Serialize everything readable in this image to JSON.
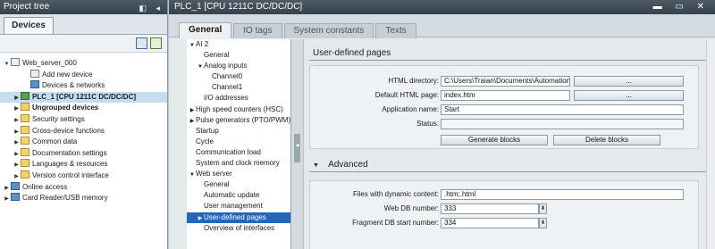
{
  "project_tree": {
    "title": "Project tree",
    "devices_tab": "Devices",
    "items": [
      {
        "label": "Web_server_000",
        "depth": 0,
        "arrow": "▼",
        "icon": "project"
      },
      {
        "label": "Add new device",
        "depth": 2,
        "arrow": "",
        "icon": "add-device"
      },
      {
        "label": "Devices & networks",
        "depth": 2,
        "arrow": "",
        "icon": "network"
      },
      {
        "label": "PLC_1 [CPU 1211C DC/DC/DC]",
        "depth": 1,
        "arrow": "▶",
        "icon": "plc",
        "selected": true
      },
      {
        "label": "Ungrouped devices",
        "depth": 1,
        "arrow": "▶",
        "icon": "folder",
        "bold": true
      },
      {
        "label": "Security settings",
        "depth": 1,
        "arrow": "▶",
        "icon": "security"
      },
      {
        "label": "Cross-device functions",
        "depth": 1,
        "arrow": "▶",
        "icon": "cross-device"
      },
      {
        "label": "Common data",
        "depth": 1,
        "arrow": "▶",
        "icon": "common-data"
      },
      {
        "label": "Documentation settings",
        "depth": 1,
        "arrow": "▶",
        "icon": "documentation"
      },
      {
        "label": "Languages & resources",
        "depth": 1,
        "arrow": "▶",
        "icon": "languages"
      },
      {
        "label": "Version control interface",
        "depth": 1,
        "arrow": "▶",
        "icon": "version-control"
      },
      {
        "label": "Online access",
        "depth": 0,
        "arrow": "▶",
        "icon": "online-access"
      },
      {
        "label": "Card Reader/USB memory",
        "depth": 0,
        "arrow": "▶",
        "icon": "card-reader"
      }
    ]
  },
  "editor": {
    "title": "PLC_1 [CPU 1211C DC/DC/DC]",
    "tabs": [
      {
        "label": "General",
        "active": true
      },
      {
        "label": "IO tags",
        "active": false
      },
      {
        "label": "System constants",
        "active": false
      },
      {
        "label": "Texts",
        "active": false
      }
    ],
    "nav": [
      {
        "label": "AI 2",
        "depth": 0,
        "arrow": "▼"
      },
      {
        "label": "General",
        "depth": 1,
        "arrow": ""
      },
      {
        "label": "Analog inputs",
        "depth": 1,
        "arrow": "▼"
      },
      {
        "label": "Channel0",
        "depth": 2,
        "arrow": ""
      },
      {
        "label": "Channel1",
        "depth": 2,
        "arrow": ""
      },
      {
        "label": "I/O addresses",
        "depth": 1,
        "arrow": ""
      },
      {
        "label": "High speed counters (HSC)",
        "depth": 0,
        "arrow": "▶"
      },
      {
        "label": "Pulse generators (PTO/PWM)",
        "depth": 0,
        "arrow": "▶"
      },
      {
        "label": "Startup",
        "depth": 0,
        "arrow": ""
      },
      {
        "label": "Cycle",
        "depth": 0,
        "arrow": ""
      },
      {
        "label": "Communication load",
        "depth": 0,
        "arrow": ""
      },
      {
        "label": "System and clock memory",
        "depth": 0,
        "arrow": ""
      },
      {
        "label": "Web server",
        "depth": 0,
        "arrow": "▼"
      },
      {
        "label": "General",
        "depth": 1,
        "arrow": ""
      },
      {
        "label": "Automatic update",
        "depth": 1,
        "arrow": ""
      },
      {
        "label": "User management",
        "depth": 1,
        "arrow": ""
      },
      {
        "label": "User-defined pages",
        "depth": 1,
        "arrow": "▶",
        "selected": true
      },
      {
        "label": "Overview of interfaces",
        "depth": 1,
        "arrow": ""
      }
    ],
    "user_defined_pages": {
      "heading": "User-defined pages",
      "html_directory_label": "HTML directory:",
      "html_directory_value": "C:\\Users\\Traian\\Documents\\Automation",
      "browse_label": "...",
      "default_html_page_label": "Default HTML page:",
      "default_html_page_value": "index.htm",
      "application_name_label": "Application name:",
      "application_name_value": "Start",
      "status_label": "Status:",
      "status_value": "",
      "generate_blocks_label": "Generate blocks",
      "delete_blocks_label": "Delete blocks"
    },
    "advanced": {
      "heading": "Advanced",
      "arrow": "▼",
      "files_dynamic_label": "Files with dynamic content:",
      "files_dynamic_value": ".htm;.html",
      "web_db_label": "Web DB number:",
      "web_db_value": "333",
      "fragment_db_label": "Fragment DB start number:",
      "fragment_db_value": "334"
    }
  }
}
